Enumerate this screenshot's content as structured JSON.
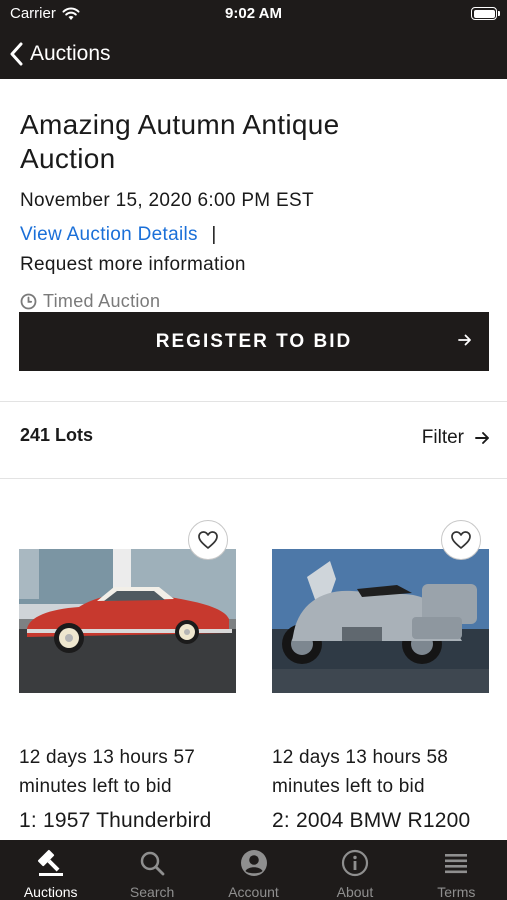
{
  "status_bar": {
    "carrier": "Carrier",
    "time": "9:02 AM"
  },
  "nav": {
    "back_label": "Auctions"
  },
  "auction": {
    "title_line1": "Amazing Autumn Antique",
    "title_line2": "Auction",
    "date": "November 15, 2020 6:00 PM EST",
    "details_link": "View Auction Details",
    "separator": "|",
    "request_info": "Request more information",
    "auction_type": "Timed Auction",
    "register_label": "REGISTER TO BID"
  },
  "lots": {
    "count_label": "241 Lots",
    "filter_label": "Filter",
    "items": [
      {
        "time_line1": "12 days 13 hours 57",
        "time_line2": "minutes left to bid",
        "title": "1: 1957 Thunderbird",
        "image": "red-classic-car"
      },
      {
        "time_line1": "12 days 13 hours 58",
        "time_line2": "minutes left to bid",
        "title": "2: 2004 BMW R1200",
        "image": "silver-touring-motorcycle"
      }
    ]
  },
  "tabs": [
    {
      "label": "Auctions",
      "icon": "gavel-icon",
      "active": true
    },
    {
      "label": "Search",
      "icon": "search-icon",
      "active": false
    },
    {
      "label": "Account",
      "icon": "account-icon",
      "active": false
    },
    {
      "label": "About",
      "icon": "info-icon",
      "active": false
    },
    {
      "label": "Terms",
      "icon": "terms-icon",
      "active": false
    }
  ],
  "colors": {
    "dark": "#1e1b1a",
    "link": "#1a6fd8",
    "muted": "#7a7a7a",
    "tab_inactive": "#8f8f8f"
  }
}
